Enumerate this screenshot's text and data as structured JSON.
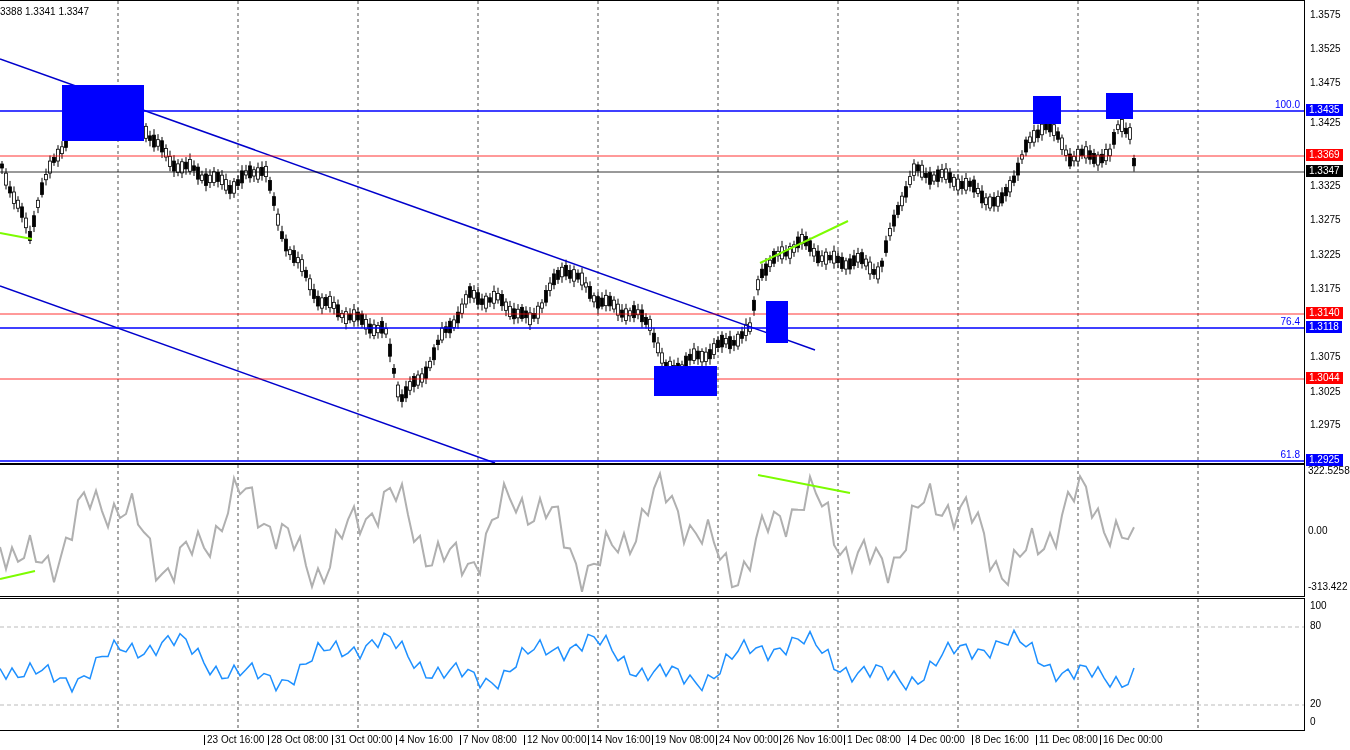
{
  "header": {
    "ohlc": "3388 1.3341 1.3347"
  },
  "price_axis": {
    "ticks": [
      "1.3575",
      "1.3525",
      "1.3475",
      "1.3425",
      "1.3325",
      "1.3275",
      "1.3225",
      "1.3175",
      "1.3075",
      "1.3025",
      "1.2975"
    ]
  },
  "levels": [
    {
      "label": "1.3435",
      "color": "#0000ff",
      "fib": "100.0"
    },
    {
      "label": "1.3369",
      "color": "#ff0000"
    },
    {
      "label": "1.3347",
      "color": "#000000"
    },
    {
      "label": "1.3140",
      "color": "#ff0000"
    },
    {
      "label": "1.3118",
      "color": "#0000ff",
      "fib": "76.4"
    },
    {
      "label": "1.3044",
      "color": "#ff0000"
    },
    {
      "label": "1.2925",
      "color": "#0000ff",
      "fib": "61.8"
    }
  ],
  "cci": {
    "ticks": [
      "322.5258",
      "0.00",
      "-313.422"
    ]
  },
  "rsi": {
    "ticks": [
      "100",
      "80",
      "20",
      "0"
    ]
  },
  "time_axis": [
    "23 Oct 16:00",
    "28 Oct 08:00",
    "31 Oct 00:00",
    "4 Nov 16:00",
    "7 Nov 08:00",
    "12 Nov 00:00",
    "14 Nov 16:00",
    "19 Nov 08:00",
    "24 Nov 00:00",
    "26 Nov 16:00",
    "1 Dec 08:00",
    "4 Dec 00:00",
    "8 Dec 16:00",
    "11 Dec 08:00",
    "16 Dec 00:00"
  ]
}
